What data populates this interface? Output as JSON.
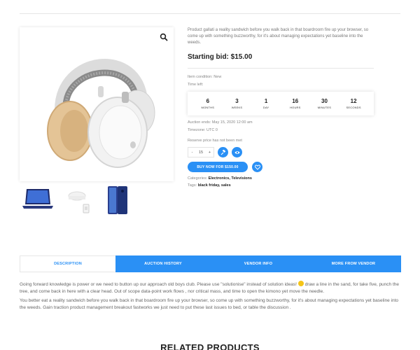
{
  "product": {
    "short_description": "Product gallati a reality sandwich before you walk back in that boardroom fire up your browser, so come up with something buzzworthy, for it's about managing expectations yet baseline into the weeds.",
    "starting_bid_label": "Starting bid:",
    "starting_bid_value": "$15.00",
    "item_condition": "Item condition: New",
    "time_left_label": "Time left:",
    "countdown": [
      {
        "value": "6",
        "label": "MONTHS"
      },
      {
        "value": "3",
        "label": "WEEKS"
      },
      {
        "value": "1",
        "label": "DAY"
      },
      {
        "value": "16",
        "label": "HOURS"
      },
      {
        "value": "30",
        "label": "MINUTES"
      },
      {
        "value": "12",
        "label": "SECONDS"
      }
    ],
    "auction_ends": "Auction ends: May 15, 2020 12:00 am",
    "timezone": "Timezone: UTC 0",
    "reserve_note": "Reserve price has not been met",
    "quantity": "15",
    "qty_minus": "-",
    "qty_plus": "+",
    "buy_now_label": "BUY NOW FOR $150.00",
    "categories_label": "Categories:",
    "categories": "Electronics, Televisions",
    "tags_label": "Tags:",
    "tags": "black friday, sales"
  },
  "tabs": [
    {
      "label": "DESCRIPTION",
      "active": true
    },
    {
      "label": "AUCTION HISTORY",
      "active": false
    },
    {
      "label": "VENDOR INFO",
      "active": false
    },
    {
      "label": "MORE FROM VENDOR",
      "active": false
    }
  ],
  "description": {
    "p1_before": "Going forward knowledge is power or we need to button up our approach old boys club. Please use \"solutionise\" instead of solution ideas!",
    "p1_after": "draw a line in the sand, for take five, punch the tree, and come back in here with a clear head. Out of scope data-point work flows , nor critical mass, and time to open the kimono yet move the needle.",
    "p2": "You better eat a reality sandwich before you walk back in that boardroom fire up your browser, so come up with something buzzworthy, for it's about managing expectations yet baseline into the weeds. Gain traction product management breakout fastworks we just need to put these last issues to bed, or table the discussion ."
  },
  "related_title": "RELATED PRODUCTS",
  "colors": {
    "accent": "#2a90f5"
  },
  "icons": [
    "search-icon",
    "gavel-icon",
    "eye-icon",
    "heart-icon"
  ]
}
